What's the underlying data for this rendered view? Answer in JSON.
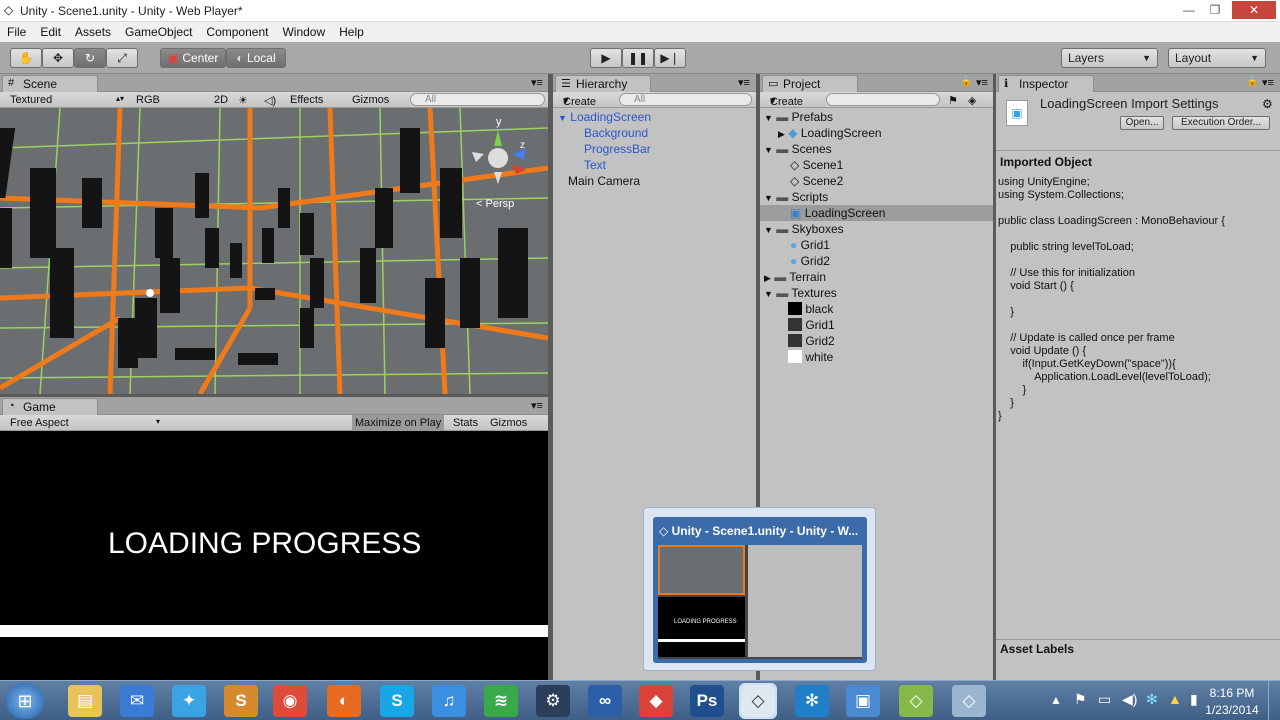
{
  "window": {
    "title": "Unity - Scene1.unity - Unity - Web Player*",
    "min": "—",
    "max": "❐",
    "close": "✕"
  },
  "menu": [
    "File",
    "Edit",
    "Assets",
    "GameObject",
    "Component",
    "Window",
    "Help"
  ],
  "toolbar": {
    "center": "Center",
    "local": "Local",
    "layers": "Layers",
    "layout": "Layout"
  },
  "scene": {
    "tab": "Scene",
    "shading": "Textured",
    "rgb": "RGB",
    "mode2d": "2D",
    "effects": "Effects",
    "gizmos": "Gizmos",
    "search_placeholder": "All",
    "persp": "Persp",
    "axis_y": "y",
    "axis_z": "z"
  },
  "game": {
    "tab": "Game",
    "aspect": "Free Aspect",
    "maximize": "Maximize on Play",
    "stats": "Stats",
    "gizmos": "Gizmos",
    "loading_text": "LOADING PROGRESS"
  },
  "hierarchy": {
    "tab": "Hierarchy",
    "create": "Create",
    "search_placeholder": "All",
    "items": [
      {
        "label": "LoadingScreen",
        "blue": true,
        "indent": 0,
        "arrow": "▼"
      },
      {
        "label": "Background",
        "blue": true,
        "indent": 1
      },
      {
        "label": "ProgressBar",
        "blue": true,
        "indent": 1
      },
      {
        "label": "Text",
        "blue": true,
        "indent": 1
      },
      {
        "label": "Main Camera",
        "blue": false,
        "indent": 0
      }
    ]
  },
  "project": {
    "tab": "Project",
    "create": "Create",
    "items": [
      {
        "label": "Prefabs",
        "type": "folder",
        "indent": 0
      },
      {
        "label": "LoadingScreen",
        "type": "prefab",
        "indent": 1
      },
      {
        "label": "Scenes",
        "type": "folder",
        "indent": 0
      },
      {
        "label": "Scene1",
        "type": "scene",
        "indent": 1
      },
      {
        "label": "Scene2",
        "type": "scene",
        "indent": 1
      },
      {
        "label": "Scripts",
        "type": "folder",
        "indent": 0
      },
      {
        "label": "LoadingScreen",
        "type": "script",
        "indent": 1,
        "selected": true
      },
      {
        "label": "Skyboxes",
        "type": "folder",
        "indent": 0
      },
      {
        "label": "Grid1",
        "type": "material",
        "indent": 1
      },
      {
        "label": "Grid2",
        "type": "material",
        "indent": 1
      },
      {
        "label": "Terrain",
        "type": "folder-closed",
        "indent": 0
      },
      {
        "label": "Textures",
        "type": "folder",
        "indent": 0
      },
      {
        "label": "black",
        "type": "tex-black",
        "indent": 1
      },
      {
        "label": "Grid1",
        "type": "tex-grid",
        "indent": 1
      },
      {
        "label": "Grid2",
        "type": "tex-grid",
        "indent": 1
      },
      {
        "label": "white",
        "type": "tex-white",
        "indent": 1
      }
    ]
  },
  "inspector": {
    "tab": "Inspector",
    "title": "LoadingScreen Import Settings",
    "open": "Open...",
    "execution_order": "Execution Order...",
    "imported_object": "Imported Object",
    "code": "using UnityEngine;\nusing System.Collections;\n\npublic class LoadingScreen : MonoBehaviour {\n\n    public string levelToLoad;\n\n    // Use this for initialization\n    void Start () {\n\n    }\n\n    // Update is called once per frame\n    void Update () {\n        if(Input.GetKeyDown(\"space\")){\n            Application.LoadLevel(levelToLoad);\n        }\n    }\n}",
    "asset_labels": "Asset Labels"
  },
  "thumbnail": {
    "title": "Unity - Scene1.unity - Unity - W...",
    "mini_text": "LOADING PROGRESS"
  },
  "taskbar": {
    "time": "8:16 PM",
    "date": "1/23/2014",
    "apps": [
      {
        "name": "explorer-icon",
        "glyph": "▤",
        "color": "#e7c35a"
      },
      {
        "name": "thunderbird-icon",
        "glyph": "✉",
        "color": "#3a7bd5"
      },
      {
        "name": "twitter-icon",
        "glyph": "✦",
        "color": "#3aa3e3"
      },
      {
        "name": "sublime-icon",
        "glyph": "S",
        "color": "#d58a2e"
      },
      {
        "name": "chrome-icon",
        "glyph": "◉",
        "color": "#dd4b39"
      },
      {
        "name": "firefox-icon",
        "glyph": "◐",
        "color": "#e66a1f"
      },
      {
        "name": "skype-icon",
        "glyph": "S",
        "color": "#19a6e6"
      },
      {
        "name": "itunes-icon",
        "glyph": "♫",
        "color": "#3b8fe0"
      },
      {
        "name": "spotify-icon",
        "glyph": "≋",
        "color": "#3aa94a"
      },
      {
        "name": "steam-icon",
        "glyph": "⚙",
        "color": "#2b3f5a"
      },
      {
        "name": "visualstudio-icon",
        "glyph": "∞",
        "color": "#2b5fa8"
      },
      {
        "name": "gem-app-icon",
        "glyph": "◆",
        "color": "#d9433a"
      },
      {
        "name": "photoshop-icon",
        "glyph": "Ps",
        "color": "#1f4f8f"
      },
      {
        "name": "unity-icon",
        "glyph": "◇",
        "color": "#dfe7f0"
      },
      {
        "name": "snowflake-app-icon",
        "glyph": "✻",
        "color": "#1f7fc8"
      },
      {
        "name": "window-app-icon",
        "glyph": "▣",
        "color": "#4a8ad0"
      },
      {
        "name": "unity-app-icon-2",
        "glyph": "◇",
        "color": "#87b94a"
      },
      {
        "name": "unity-app-icon-3",
        "glyph": "◇",
        "color": "#9bb4d0"
      }
    ]
  }
}
